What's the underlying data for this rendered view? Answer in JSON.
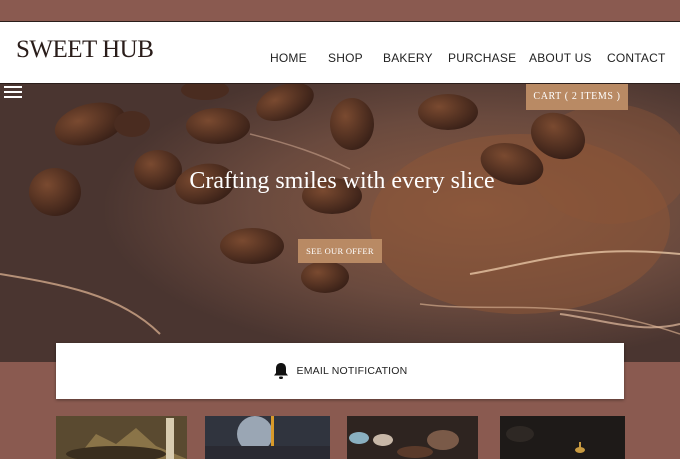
{
  "brand": {
    "logo": "SWEET HUB"
  },
  "nav": [
    {
      "label": "HOME"
    },
    {
      "label": "SHOP"
    },
    {
      "label": "BAKERY"
    },
    {
      "label": "PURCHASE"
    },
    {
      "label": "ABOUT US"
    },
    {
      "label": "CONTACT"
    }
  ],
  "cart": {
    "label": "CART  ( 2  ITEMS )"
  },
  "hero": {
    "headline": "Crafting smiles with every slice",
    "cta_label": "SEE OUR OFFER"
  },
  "notification": {
    "label": "EMAIL NOTIFICATION"
  },
  "colors": {
    "brown_bg": "#8a5a50",
    "accent": "#b98a64",
    "dark_text": "#2a1d1a"
  },
  "icons": [
    "hamburger-menu-icon",
    "bell-icon"
  ]
}
